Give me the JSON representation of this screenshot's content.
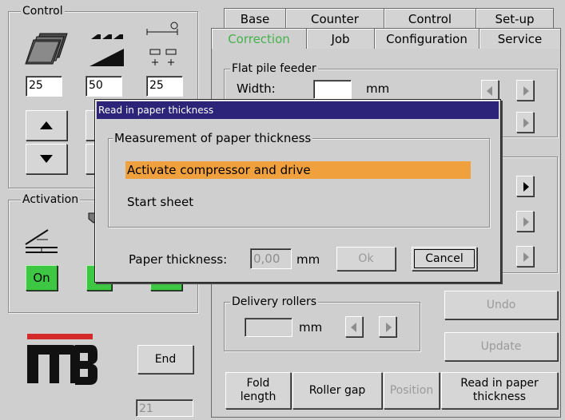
{
  "control_panel": {
    "title": "Control",
    "values": [
      "25",
      "50",
      "25"
    ]
  },
  "activation_panel": {
    "title": "Activation",
    "on_label": "On"
  },
  "logo_text": "M3",
  "end_button": "End",
  "bottom_value": "21",
  "tabs_row1": [
    "Base",
    "Counter",
    "Control",
    "Set-up"
  ],
  "tabs_row2": [
    "Correction",
    "Job",
    "Configuration",
    "Service"
  ],
  "flat_pile_feeder": {
    "title": "Flat pile feeder",
    "width_label": "Width:",
    "unit": "mm"
  },
  "delivery_rollers": {
    "title": "Delivery rollers",
    "unit": "mm"
  },
  "side_buttons": {
    "undo": "Undo",
    "update": "Update"
  },
  "bottom_buttons": {
    "fold_length": "Fold length",
    "roller_gap": "Roller gap",
    "position": "Position",
    "read_thickness": "Read in paper thickness"
  },
  "dialog": {
    "title": "Read in paper thickness",
    "group_title": "Measurement of paper thickness",
    "items": [
      "Activate compressor and drive",
      "Start sheet"
    ],
    "thickness_label": "Paper thickness:",
    "thickness_value": "0,00",
    "thickness_unit": "mm",
    "ok": "Ok",
    "cancel": "Cancel"
  },
  "colors": {
    "accent_highlight": "#f0a03c",
    "titlebar": "#2c2478",
    "active_tab_text": "#44b24a",
    "on_button": "#3ec743",
    "logo_red": "#d42a2a"
  }
}
